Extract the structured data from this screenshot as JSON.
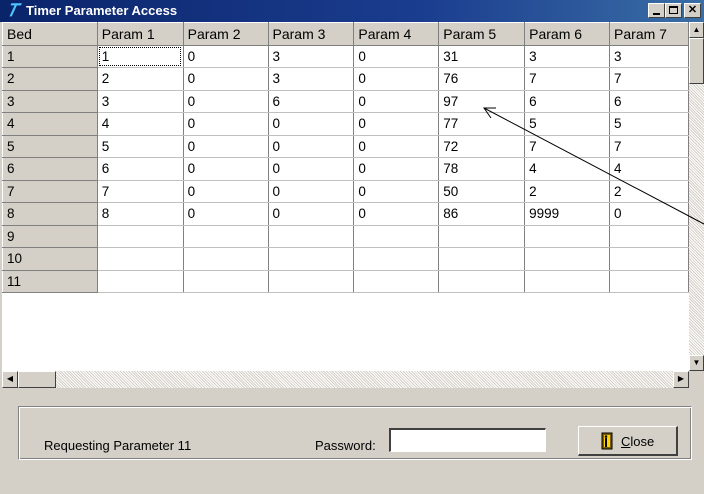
{
  "window": {
    "title": "Timer Parameter Access"
  },
  "grid": {
    "headers": [
      "Bed",
      "Param 1",
      "Param 2",
      "Param 3",
      "Param 4",
      "Param 5",
      "Param 6",
      "Param 7"
    ],
    "rows": [
      {
        "bed": "1",
        "cells": [
          "1",
          "0",
          "3",
          "0",
          "31",
          "3",
          "3"
        ]
      },
      {
        "bed": "2",
        "cells": [
          "2",
          "0",
          "3",
          "0",
          "76",
          "7",
          "7"
        ]
      },
      {
        "bed": "3",
        "cells": [
          "3",
          "0",
          "6",
          "0",
          "97",
          "6",
          "6"
        ]
      },
      {
        "bed": "4",
        "cells": [
          "4",
          "0",
          "0",
          "0",
          "77",
          "5",
          "5"
        ]
      },
      {
        "bed": "5",
        "cells": [
          "5",
          "0",
          "0",
          "0",
          "72",
          "7",
          "7"
        ]
      },
      {
        "bed": "6",
        "cells": [
          "6",
          "0",
          "0",
          "0",
          "78",
          "4",
          "4"
        ]
      },
      {
        "bed": "7",
        "cells": [
          "7",
          "0",
          "0",
          "0",
          "50",
          "2",
          "2"
        ]
      },
      {
        "bed": "8",
        "cells": [
          "8",
          "0",
          "0",
          "0",
          "86",
          "9999",
          "0"
        ]
      },
      {
        "bed": "9",
        "cells": [
          "",
          "",
          "",
          "",
          "",
          "",
          ""
        ]
      },
      {
        "bed": "10",
        "cells": [
          "",
          "",
          "",
          "",
          "",
          "",
          ""
        ]
      },
      {
        "bed": "11",
        "cells": [
          "",
          "",
          "",
          "",
          "",
          "",
          ""
        ]
      }
    ]
  },
  "footer": {
    "status_text": "Requesting Parameter 11",
    "password_label": "Password:",
    "password_value": "",
    "close_label_first": "C",
    "close_label_rest": "lose"
  },
  "icons": {
    "app": "timer-icon",
    "close_button": "door-exit-icon"
  },
  "colors": {
    "title_bar": "#0a246a",
    "face": "#d4d0c8"
  }
}
